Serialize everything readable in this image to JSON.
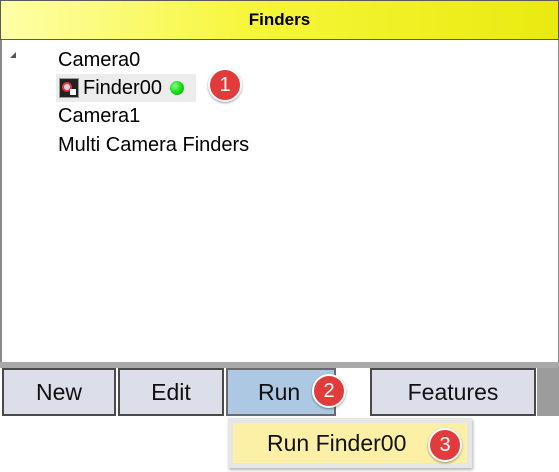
{
  "panel": {
    "title": "Finders"
  },
  "tree": {
    "camera0": "Camera0",
    "finder00": "Finder00",
    "camera1": "Camera1",
    "multi": "Multi Camera Finders"
  },
  "toolbar": {
    "new_label": "New",
    "edit_label": "Edit",
    "run_label": "Run",
    "features_label": "Features"
  },
  "menu": {
    "run_finder_label": "Run Finder00"
  },
  "badges": {
    "one": "1",
    "two": "2",
    "three": "3"
  },
  "colors": {
    "header_yellow": "#eaea10",
    "status_green": "#1ee01e",
    "badge_red": "#e23b3b",
    "active_button": "#acc8e3",
    "menu_highlight": "#fbf0a6"
  },
  "icons": {
    "expander": "expander-triangle-icon",
    "finder": "camera-finder-icon",
    "status": "status-dot-icon"
  }
}
